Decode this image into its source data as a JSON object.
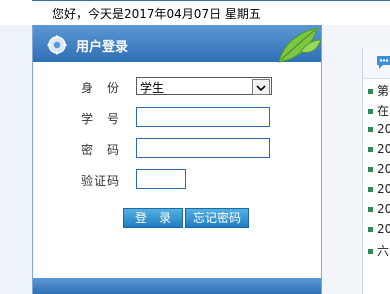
{
  "header": {
    "greeting": "您好，今天是2017年04月07日 星期五"
  },
  "login_panel": {
    "title": "用户登录",
    "identity_label": "身　份",
    "identity_value": "学生",
    "student_id_label": "学　号",
    "student_id_value": "",
    "password_label": "密　码",
    "password_value": "",
    "captcha_label": "验证码",
    "captcha_value": "",
    "login_button": "登　录",
    "forgot_button": "忘记密码"
  },
  "right_panel": {
    "items": [
      "第",
      "在",
      "20",
      "20",
      "20",
      "20",
      "20",
      "20",
      "六"
    ]
  },
  "colors": {
    "header_blue": "#2f6fb4",
    "button_blue": "#1f7cc1",
    "bullet_green": "#2e8b57"
  }
}
